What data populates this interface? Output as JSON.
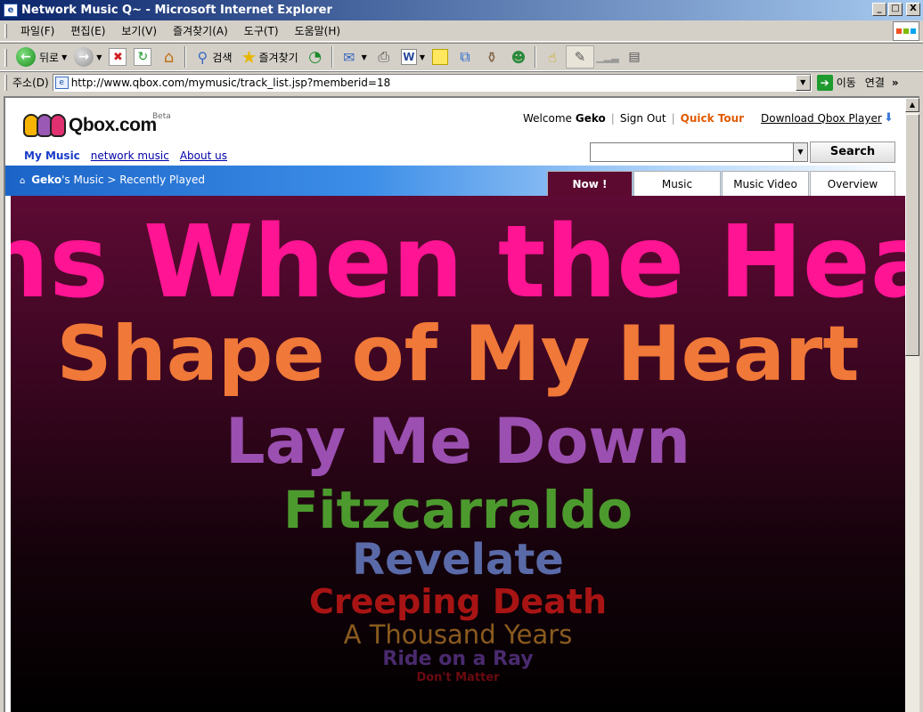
{
  "window": {
    "title": "Network Music Q~ - Microsoft Internet Explorer",
    "buttons": [
      "_",
      "□",
      "X"
    ]
  },
  "menubar": [
    "파일(F)",
    "편집(E)",
    "보기(V)",
    "즐겨찾기(A)",
    "도구(T)",
    "도움말(H)"
  ],
  "toolbar": {
    "back_label": "뒤로",
    "search_label": "검색",
    "favorites_label": "즐겨찾기"
  },
  "addressbar": {
    "label": "주소(D)",
    "url": "http://www.qbox.com/mymusic/track_list.jsp?memberid=18",
    "go_label": "이동",
    "links_label": "연결"
  },
  "site": {
    "logo_text": "Qbox.com",
    "beta": "Beta",
    "nav": {
      "my_music": "My Music",
      "network_music": "network music",
      "about": "About us"
    },
    "welcome": "Welcome",
    "user": "Geko",
    "sign_out": "Sign Out",
    "quick_tour": "Quick Tour",
    "download": "Download Qbox Player",
    "search_button": "Search",
    "search_value": "",
    "breadcrumb": {
      "user": "Geko",
      "suffix": "'s Music > Recently Played"
    },
    "tabs": [
      {
        "label": "Now !",
        "active": true
      },
      {
        "label": "Music",
        "active": false
      },
      {
        "label": "Music Video",
        "active": false
      },
      {
        "label": "Overview",
        "active": false
      }
    ]
  },
  "songs": [
    {
      "title": "ns When the Hea",
      "color": "#ff1493"
    },
    {
      "title": "Shape of My Heart",
      "color": "#f07838"
    },
    {
      "title": "Lay Me Down",
      "color": "#9b4fb0"
    },
    {
      "title": "Fitzcarraldo",
      "color": "#4c9a2e"
    },
    {
      "title": "Revelate",
      "color": "#5a6aa8"
    },
    {
      "title": "Creeping Death",
      "color": "#a81414"
    },
    {
      "title": "A Thousand Years",
      "color": "#8a5a1e"
    },
    {
      "title": "Ride on a Ray",
      "color": "#4a2a6e"
    },
    {
      "title": "Don't Matter",
      "color": "#6a0a10"
    },
    {
      "title": "",
      "color": "#3a0a12"
    }
  ]
}
